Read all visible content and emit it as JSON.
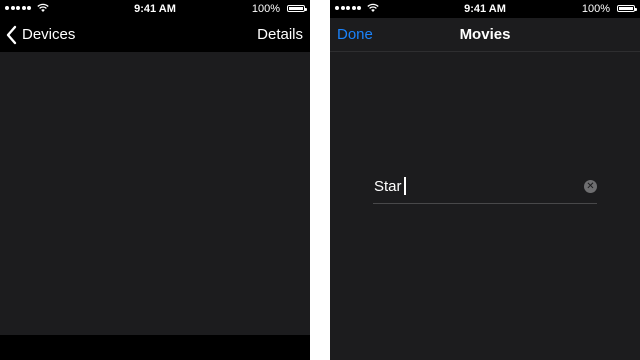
{
  "screen_left": {
    "status_bar": {
      "time": "9:41 AM",
      "battery": "100%"
    },
    "nav": {
      "back_label": "Devices",
      "right_action": "Details"
    }
  },
  "screen_right": {
    "status_bar": {
      "time": "9:41 AM",
      "battery": "100%"
    },
    "nav": {
      "left_action": "Done",
      "title": "Movies"
    },
    "search": {
      "value": "Star"
    }
  },
  "colors": {
    "accent": "#1a82fb",
    "background": "#1c1c1e",
    "bar": "#000000"
  },
  "icons": [
    "signal-dots-icon",
    "wifi-icon",
    "battery-icon",
    "chevron-left-icon",
    "clear-text-icon"
  ]
}
